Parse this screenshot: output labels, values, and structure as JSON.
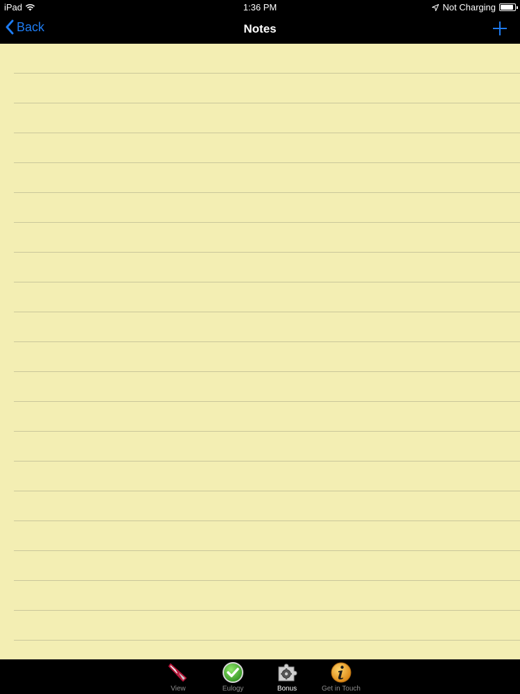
{
  "status_bar": {
    "device": "iPad",
    "time": "1:36 PM",
    "charging_status": "Not Charging",
    "battery_level": 0.9
  },
  "nav_bar": {
    "back_label": "Back",
    "title": "Notes",
    "add_icon": "plus-icon"
  },
  "notepad": {
    "text": "",
    "paper_color": "#f3eeb3",
    "line_color": "#c9c69a"
  },
  "tab_bar": {
    "selected": "Bonus",
    "tabs": [
      {
        "label": "View",
        "icon": "pen-nib-icon"
      },
      {
        "label": "Eulogy",
        "icon": "checkmark-icon"
      },
      {
        "label": "Bonus",
        "icon": "gear-puzzle-icon"
      },
      {
        "label": "Get in Touch",
        "icon": "info-icon"
      }
    ]
  },
  "colors": {
    "accent": "#1e7cf2",
    "bar_background": "#000000"
  }
}
